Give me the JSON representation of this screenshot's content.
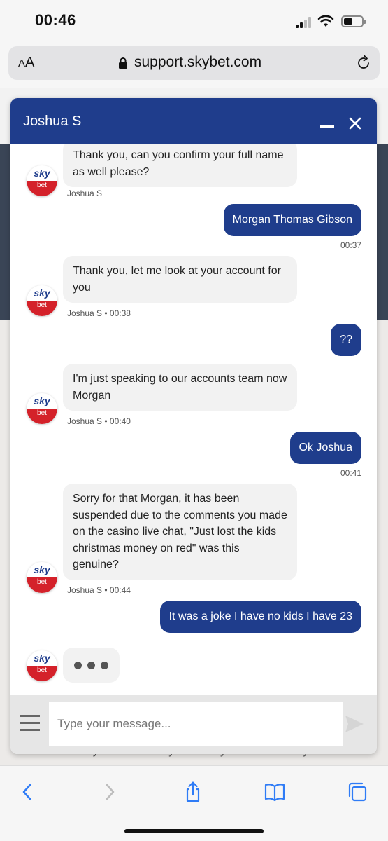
{
  "status_bar": {
    "time": "00:46"
  },
  "browser": {
    "text_size_label": "A",
    "text_size_label_large": "A",
    "url": "support.skybet.com"
  },
  "background_page": {
    "partial_text": "Occasionally due to security reasons your account may have"
  },
  "chat": {
    "agent_name": "Joshua S",
    "brand": {
      "top": "sky",
      "bottom": "bet"
    },
    "messages": [
      {
        "from": "agent",
        "text": "Thank you, can you confirm your full name as well please?",
        "meta": "Joshua S"
      },
      {
        "from": "user",
        "text": "Morgan Thomas Gibson",
        "meta": "00:37"
      },
      {
        "from": "agent",
        "text": "Thank you, let me look at your account for you",
        "meta": "Joshua S • 00:38"
      },
      {
        "from": "user",
        "text": "??",
        "meta": ""
      },
      {
        "from": "agent",
        "text": "I'm just speaking to our accounts team now Morgan",
        "meta": "Joshua S • 00:40"
      },
      {
        "from": "user",
        "text": "Ok Joshua",
        "meta": "00:41"
      },
      {
        "from": "agent",
        "text": "Sorry for that Morgan, it has been suspended due to the comments you made on the casino live chat, \"Just lost the kids christmas money on red\" was this genuine?",
        "meta": "Joshua S • 00:44"
      },
      {
        "from": "user",
        "text": "It was a joke I have no kids I have 23",
        "meta": ""
      }
    ],
    "input_placeholder": "Type your message...",
    "colors": {
      "header": "#1f3d8c",
      "user_bubble": "#1f3d8c",
      "agent_bubble": "#f2f2f2",
      "brand_red": "#d4212a"
    }
  },
  "toolbar": {
    "icons": [
      "back-icon",
      "forward-icon",
      "share-icon",
      "bookmarks-icon",
      "tabs-icon"
    ]
  }
}
